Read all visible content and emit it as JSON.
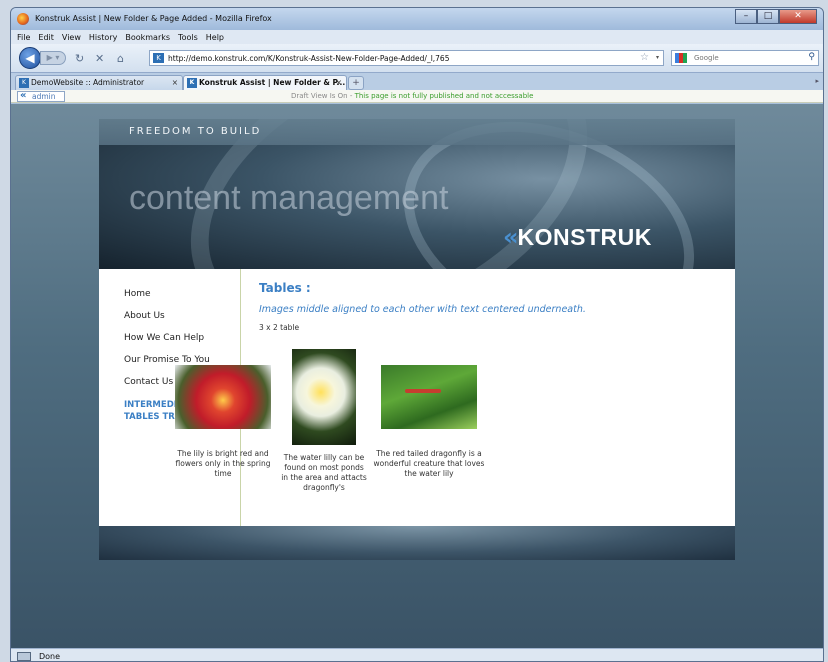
{
  "window": {
    "title": "Konstruk Assist | New Folder & Page Added - Mozilla Firefox",
    "min_glyph": "–",
    "max_glyph": "□",
    "close_glyph": "✕"
  },
  "menu": {
    "items": [
      "File",
      "Edit",
      "View",
      "History",
      "Bookmarks",
      "Tools",
      "Help"
    ]
  },
  "nav": {
    "url": "http://demo.konstruk.com/K/Konstruk-Assist-New-Folder-Page-Added/_l,765",
    "search_placeholder": "Google",
    "back_glyph": "◀",
    "forward_glyph": "▶ ▾",
    "reload_glyph": "↻",
    "stop_glyph": "✕",
    "home_glyph": "⌂",
    "star_glyph": "☆",
    "drop_glyph": "▾",
    "search_glyph": "⚲",
    "fav_glyph": "K"
  },
  "tabs": {
    "items": [
      {
        "label": "DemoWebsite :: Administrator"
      },
      {
        "label": "Konstruk Assist | New Folder & P..."
      }
    ],
    "close_glyph": "×",
    "newtab_glyph": "+",
    "scroll_glyph": "▸"
  },
  "admin_bar": {
    "admin_label": "admin",
    "draft_prefix": "Draft View Is On - ",
    "draft_warning": "This page is not fully published and not accessable"
  },
  "site": {
    "tagline": "FREEDOM TO BUILD",
    "hero_text": "content management",
    "logo_chevron": "«",
    "logo_text": "KONSTRUK",
    "menu": [
      "Home",
      "About Us",
      "How We Can Help",
      "Our Promise To You",
      "Contact Us"
    ],
    "menu_active_line1": "INTERMEDIATE -",
    "menu_active_line2": "TABLES TRAINING",
    "heading": "Tables :",
    "subheading": "Images middle aligned to each other with text centered underneath.",
    "meta": "3 x 2 table",
    "cells": [
      {
        "caption": "The lily is bright red and flowers only in the spring time"
      },
      {
        "caption": "The water lilly can be found on most ponds in the area and attacts dragonfly's"
      },
      {
        "caption": "The red tailed dragonfly is a wonderful creature that loves the water lily"
      }
    ]
  },
  "status": {
    "text": "Done"
  }
}
